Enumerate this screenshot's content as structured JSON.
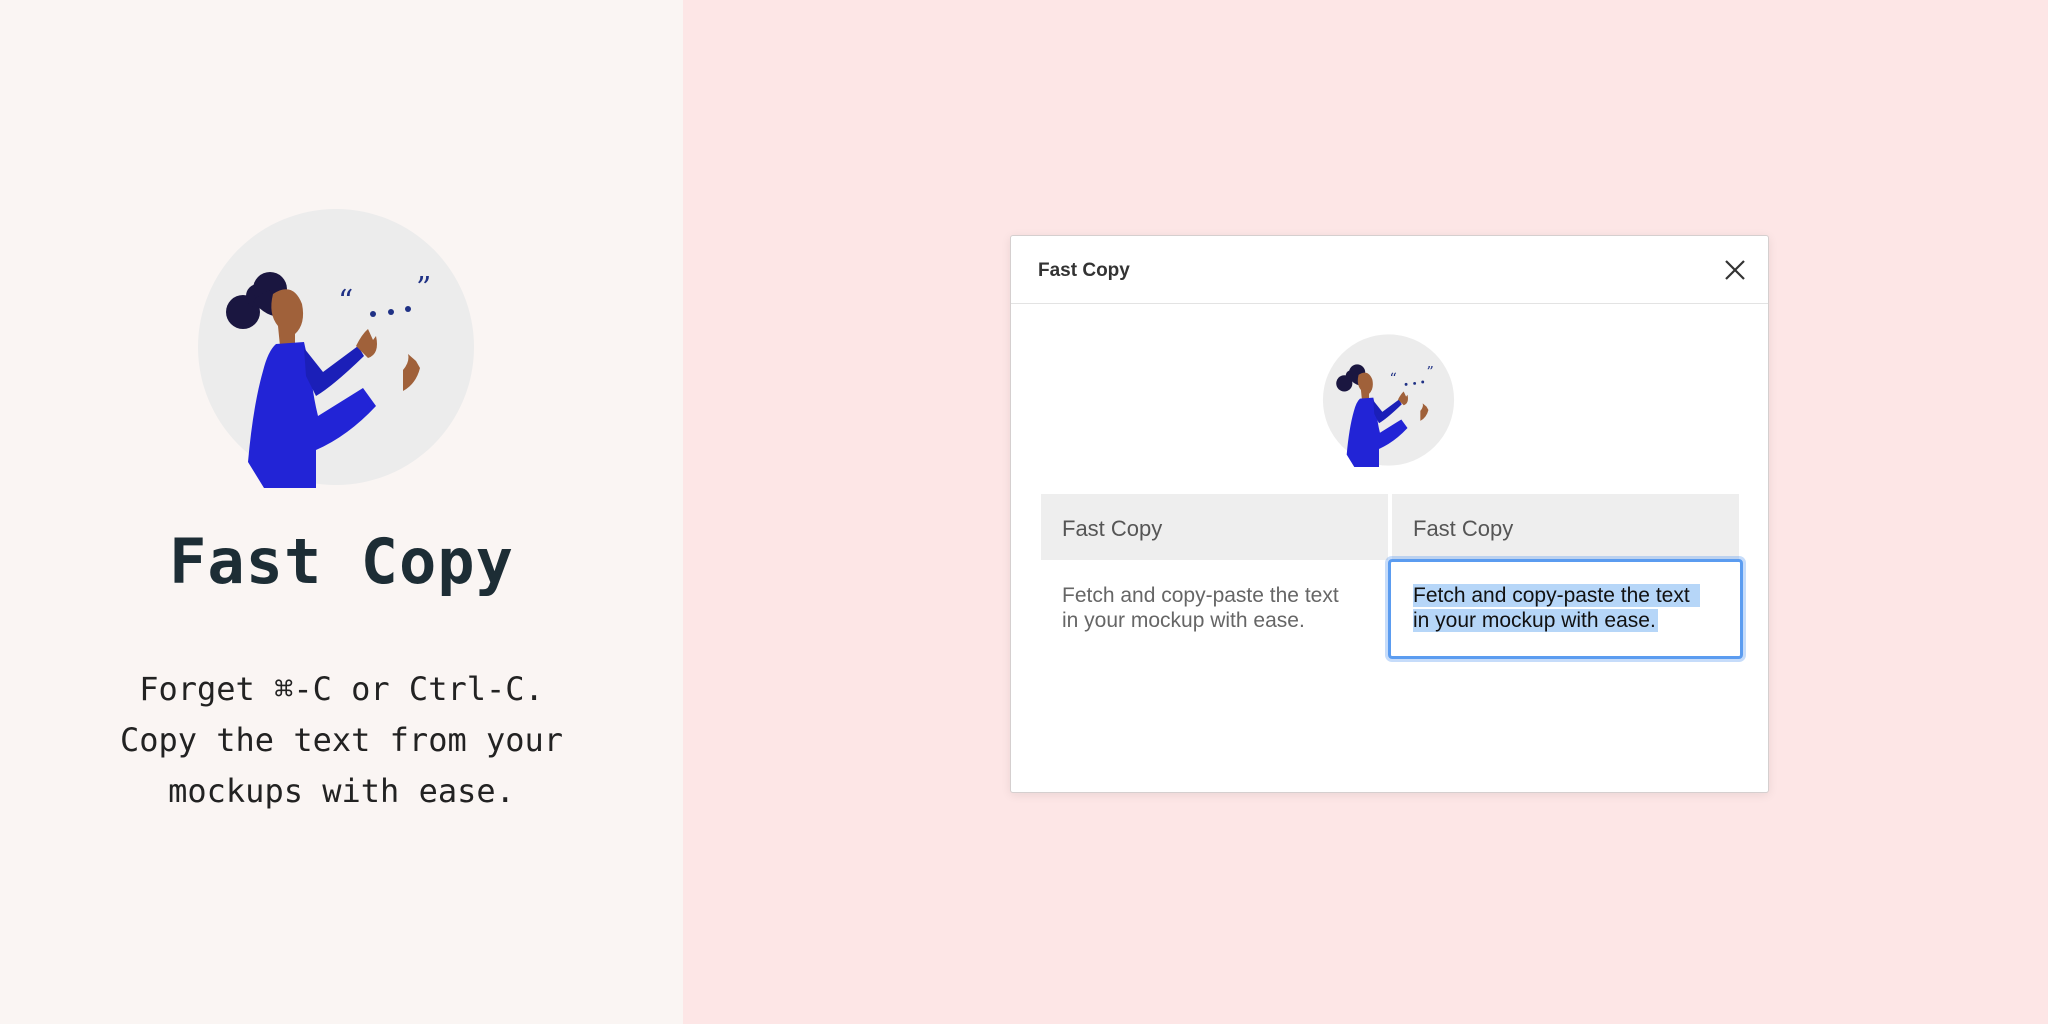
{
  "hero": {
    "title": "Fast Copy",
    "description": [
      "Forget ⌘-C or Ctrl-C.",
      "Copy the text from your",
      "mockups with ease."
    ],
    "illustration": "woman-speaking-with-quote-marks",
    "quote_text": "“ . . . ”"
  },
  "dialog": {
    "title": "Fast Copy",
    "close_icon": "close-icon",
    "table": {
      "headers": [
        "Fast Copy",
        "Fast Copy"
      ],
      "cells": [
        [
          "Fetch and copy-paste the text",
          "in your mockup with ease."
        ],
        [
          "Fetch and copy-paste the text",
          "in your mockup with ease."
        ]
      ],
      "selected_cell": 1
    }
  },
  "colors": {
    "left_background": "#faf5f3",
    "right_background": "#fde6e6",
    "selection_border": "#5b9cf0",
    "selection_highlight": "#b6d6f8",
    "figure_blue": "#2224d6",
    "skin": "#a0613a",
    "hair": "#1a1640"
  }
}
